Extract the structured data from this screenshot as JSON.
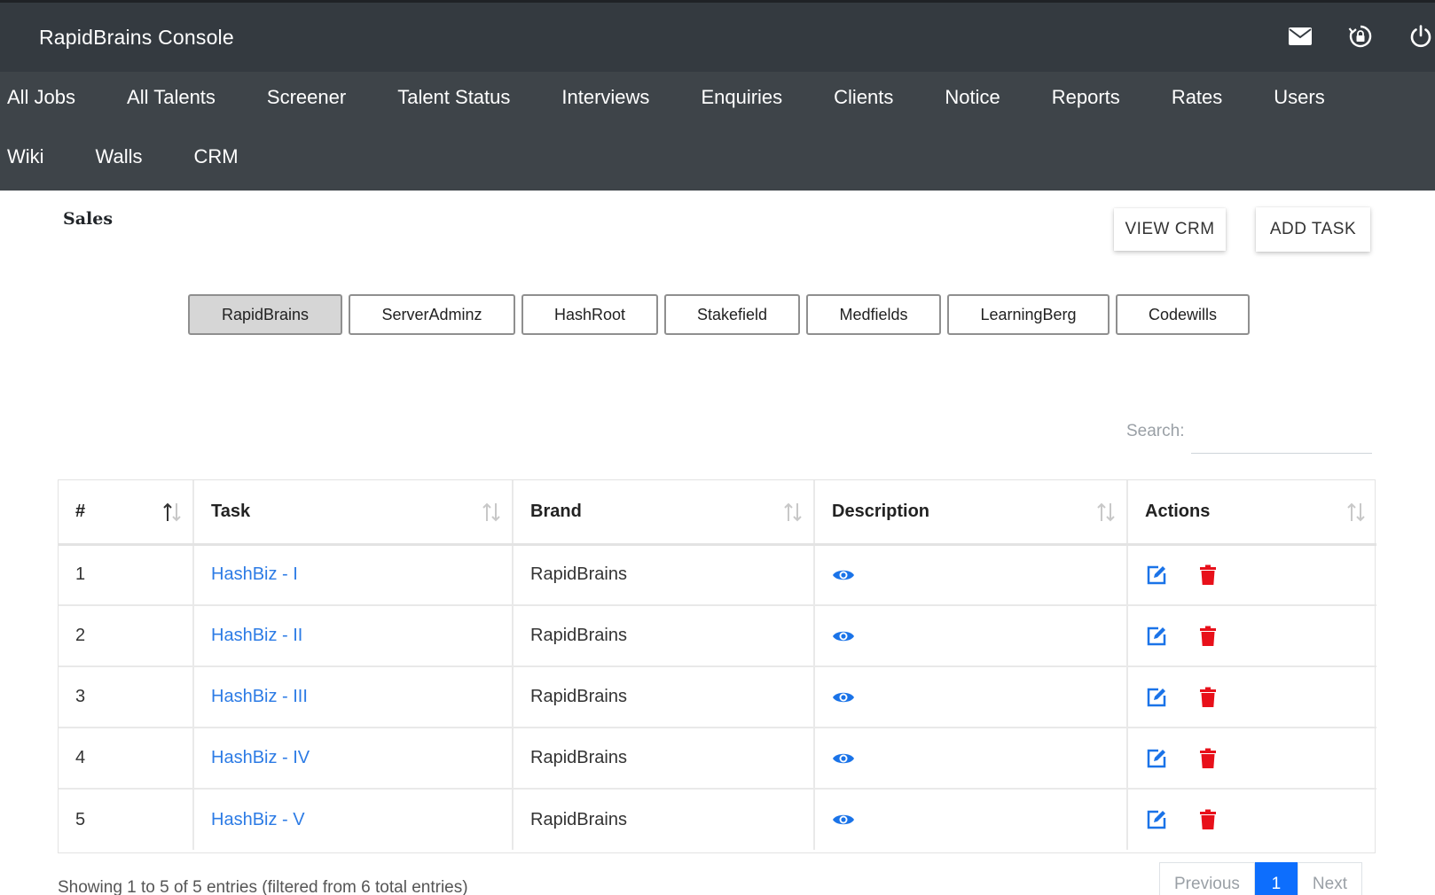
{
  "app": {
    "title": "RapidBrains Console"
  },
  "nav": {
    "row1": [
      "All Jobs",
      "All Talents",
      "Screener",
      "Talent Status",
      "Interviews",
      "Enquiries",
      "Clients",
      "Notice",
      "Reports",
      "Rates",
      "Users"
    ],
    "row2": [
      "Wiki",
      "Walls",
      "CRM"
    ]
  },
  "page": {
    "title": "Sales",
    "view_crm_label": "VIEW CRM",
    "add_task_label": "ADD TASK"
  },
  "brand_tabs": {
    "items": [
      "RapidBrains",
      "ServerAdminz",
      "HashRoot",
      "Stakefield",
      "Medfields",
      "LearningBerg",
      "Codewills"
    ],
    "active": "RapidBrains"
  },
  "search": {
    "label": "Search:",
    "value": ""
  },
  "table": {
    "headers": [
      "#",
      "Task",
      "Brand",
      "Description",
      "Actions"
    ],
    "rows": [
      {
        "num": "1",
        "task": "HashBiz - I",
        "brand": "RapidBrains"
      },
      {
        "num": "2",
        "task": "HashBiz - II",
        "brand": "RapidBrains"
      },
      {
        "num": "3",
        "task": "HashBiz - III",
        "brand": "RapidBrains"
      },
      {
        "num": "4",
        "task": "HashBiz - IV",
        "brand": "RapidBrains"
      },
      {
        "num": "5",
        "task": "HashBiz - V",
        "brand": "RapidBrains"
      }
    ]
  },
  "footer": {
    "info": "Showing 1 to 5 of 5 entries (filtered from 6 total entries)",
    "prev_label": "Previous",
    "page_label": "1",
    "next_label": "Next"
  },
  "icons": {
    "topbar": [
      "mail-icon",
      "lock-reset-icon",
      "power-icon"
    ],
    "description": "eye-icon",
    "edit": "edit-icon",
    "delete": "trash-icon",
    "sort": "sort-arrows-icon"
  },
  "colors": {
    "topbar": "#343a40",
    "navbar": "#3e4449",
    "link": "#2c7be5",
    "delete": "#e8101a",
    "active_page": "#0d6efd"
  }
}
